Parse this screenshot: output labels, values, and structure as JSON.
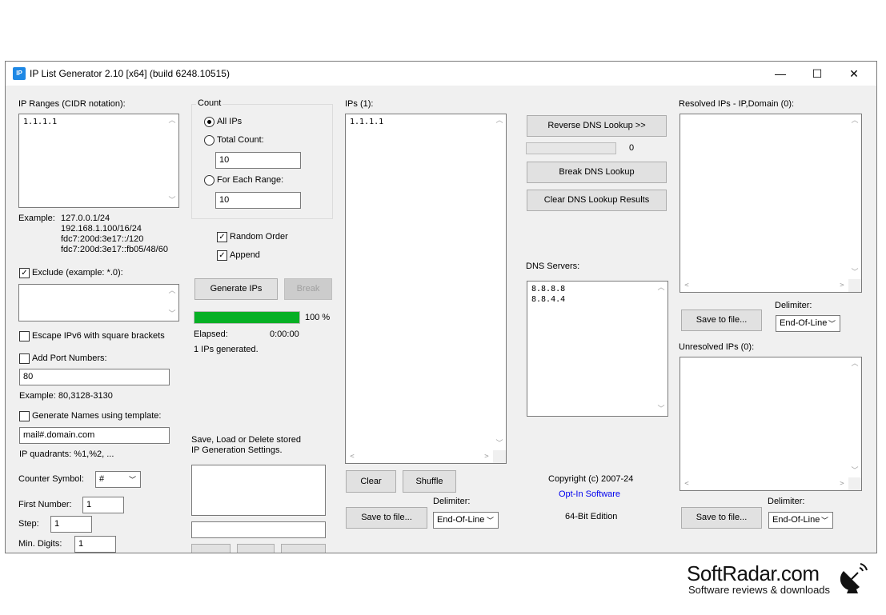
{
  "window": {
    "title": "IP List Generator 2.10 [x64] (build 6248.10515)",
    "app_icon_text": "IP",
    "minimize": "—",
    "maximize": "☐",
    "close": "✕"
  },
  "ranges": {
    "label": "IP Ranges (CIDR notation):",
    "value": "1.1.1.1",
    "example_label": "Example:",
    "examples": [
      "127.0.0.1/24",
      "192.168.1.100/16/24",
      "fdc7:200d:3e17::/120",
      "fdc7:200d:3e17::fb05/48/60"
    ]
  },
  "exclude": {
    "label": "Exclude (example: *.0):",
    "checked": true,
    "value": ""
  },
  "escape_ipv6": {
    "label": "Escape IPv6 with square brackets",
    "checked": false
  },
  "port": {
    "label": "Add Port Numbers:",
    "checked": false,
    "value": "80",
    "example": "Example: 80,3128-3130"
  },
  "names": {
    "label": "Generate Names using template:",
    "checked": false,
    "template": "mail#.domain.com",
    "quadrants": "IP quadrants: %1,%2, ..."
  },
  "counter": {
    "symbol_label": "Counter Symbol:",
    "symbol_value": "#",
    "first_label": "First Number:",
    "first_value": "1",
    "step_label": "Step:",
    "step_value": "1",
    "min_digits_label": "Min. Digits:",
    "min_digits_value": "1"
  },
  "count": {
    "group_label": "Count",
    "all_ips": "All IPs",
    "total_count": "Total Count:",
    "total_value": "10",
    "each_range": "For Each Range:",
    "each_value": "10",
    "selected": "all"
  },
  "options": {
    "random_order": "Random Order",
    "random_checked": true,
    "append": "Append",
    "append_checked": true
  },
  "generate": {
    "generate_button": "Generate IPs",
    "break_button": "Break",
    "progress_percent": 100,
    "progress_text": "100 %",
    "elapsed_label": "Elapsed:",
    "elapsed_value": "0:00:00",
    "status": "1 IPs generated."
  },
  "stored": {
    "label_line1": "Save, Load or Delete stored",
    "label_line2": "IP Generation Settings."
  },
  "ips": {
    "label": "IPs (1):",
    "value": "1.1.1.1",
    "clear_button": "Clear",
    "shuffle_button": "Shuffle",
    "save_button": "Save to file...",
    "delimiter_label": "Delimiter:",
    "delimiter_value": "End-Of-Line"
  },
  "dns": {
    "reverse_button": "Reverse DNS Lookup >>",
    "progress_count": "0",
    "break_button": "Break DNS Lookup",
    "clear_button": "Clear DNS Lookup Results",
    "servers_label": "DNS Servers:",
    "servers_value": "8.8.8.8\n8.8.4.4",
    "copyright": "Copyright (c) 2007-24",
    "link": "Opt-In Software",
    "edition": "64-Bit Edition"
  },
  "resolved": {
    "label": "Resolved IPs - IP,Domain (0):",
    "save_button": "Save to file...",
    "delimiter_label": "Delimiter:",
    "delimiter_value": "End-Of-Line"
  },
  "unresolved": {
    "label": "Unresolved IPs (0):",
    "save_button": "Save to file...",
    "delimiter_label": "Delimiter:",
    "delimiter_value": "End-Of-Line"
  },
  "watermark": {
    "brand": "SoftRadar.com",
    "tagline": "Software reviews & downloads"
  },
  "colors": {
    "progress": "#06b025",
    "link": "#0000ee",
    "dialog_bg": "#f0f0f0",
    "app_icon": "#1e88e5"
  }
}
